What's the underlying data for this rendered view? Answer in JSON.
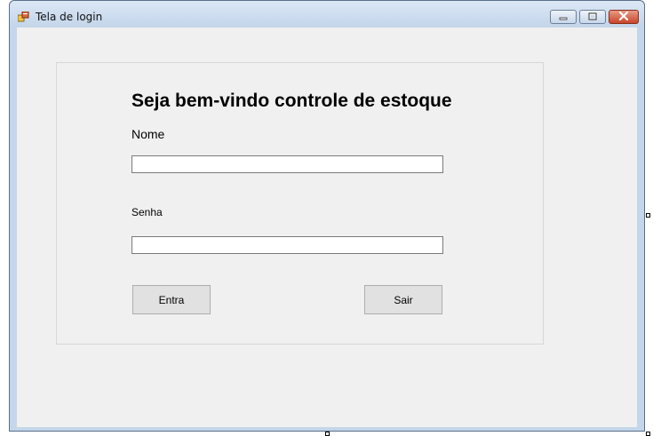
{
  "window": {
    "title": "Tela de login",
    "icon": "form-icon",
    "controls": {
      "minimize": "minimize-icon",
      "maximize": "maximize-icon",
      "close": "close-icon"
    }
  },
  "form": {
    "heading": "Seja bem-vindo controle de estoque",
    "name_label": "Nome",
    "name_value": "",
    "password_label": "Senha",
    "password_value": "",
    "enter_button": "Entra",
    "exit_button": "Sair"
  },
  "colors": {
    "form_background": "#f0f0f0",
    "button_background": "#e1e1e1",
    "close_button": "#c8462a"
  }
}
